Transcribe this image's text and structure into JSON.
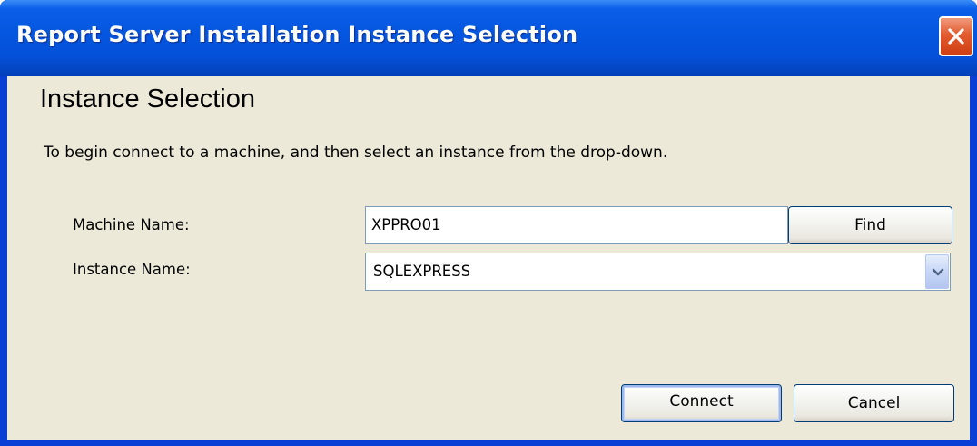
{
  "window": {
    "title": "Report Server Installation Instance Selection",
    "close_icon": "close-icon"
  },
  "content": {
    "heading": "Instance Selection",
    "description": "To begin connect to a machine, and then select an instance from the drop-down."
  },
  "form": {
    "machine_label": "Machine Name:",
    "machine_value": "XPPRO01",
    "find_label": "Find",
    "instance_label": "Instance Name:",
    "instance_value": "SQLEXPRESS",
    "dropdown_icon": "chevron-down-icon"
  },
  "footer": {
    "connect_label": "Connect",
    "cancel_label": "Cancel"
  },
  "colors": {
    "titlebar": "#0a5ee8",
    "client_background": "#ece9d8",
    "close_button": "#e25b2e",
    "input_border": "#7f9db9"
  }
}
